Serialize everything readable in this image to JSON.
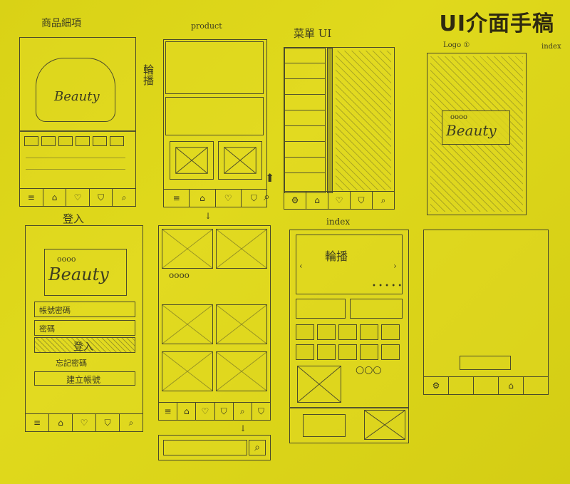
{
  "title": "UI介面手稿",
  "labels": {
    "product_detail": "商品細項",
    "product": "product",
    "menu_ui": "菜單 UI",
    "logo_note": "Logo ① ",
    "index_note_top": "index",
    "carousel_side": "輪播",
    "login": "登入",
    "index": "index",
    "carousel": "輪播",
    "beauty": "Beauty",
    "dots": "oooo",
    "account": "帳號密碼",
    "password": "密碼",
    "login_btn": "登入",
    "forgot": "忘記密碼",
    "register": "建立帳號"
  },
  "icons": {
    "menu": "≡",
    "home": "⌂",
    "heart": "♡",
    "bag": "⛉",
    "search": "⌕",
    "up": "⬆",
    "down": "↓"
  },
  "colors": {
    "paper": "#dcd41a",
    "pencil": "#4a4a2a"
  }
}
